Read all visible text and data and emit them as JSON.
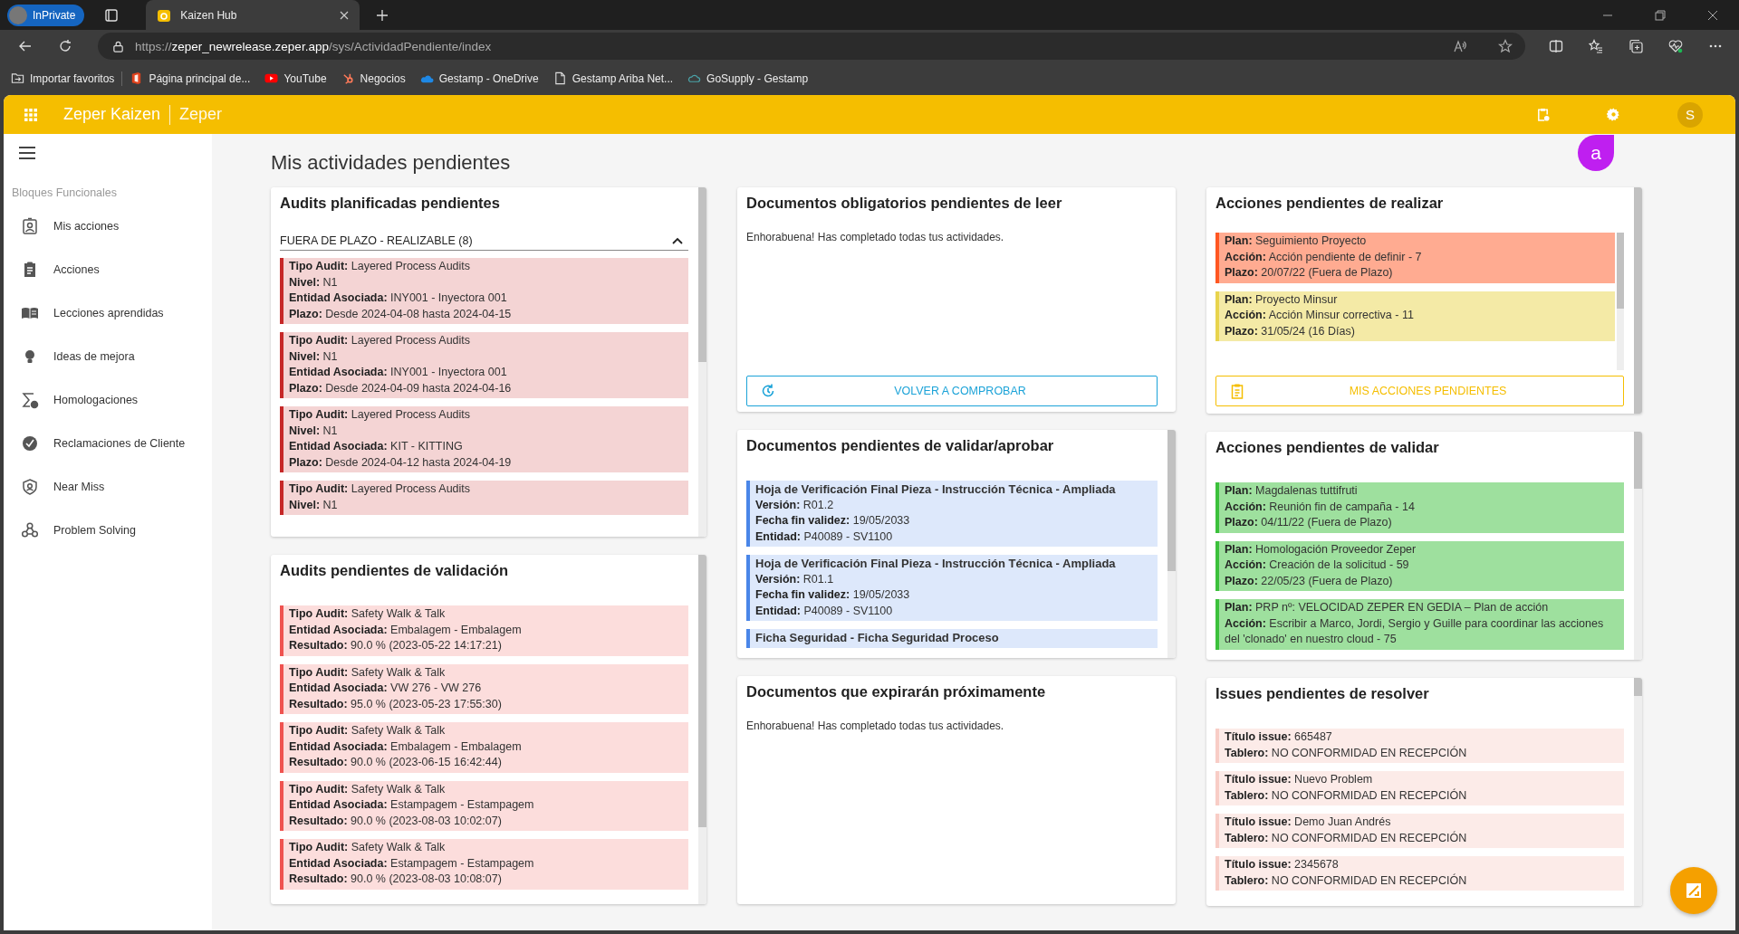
{
  "browser": {
    "private_label": "InPrivate",
    "tabs": [
      {
        "title": "Kaizen Hub",
        "selected": true
      }
    ],
    "address": {
      "scheme": "https://",
      "host": "zeper_newrelease.zeper.app",
      "path": "/sys/ActividadPendiente/index"
    },
    "bookmarks": [
      "Importar favoritos",
      "Página principal de...",
      "YouTube",
      "Negocios",
      "Gestamp - OneDrive",
      "Gestamp Ariba Net...",
      "GoSupply - Gestamp"
    ]
  },
  "app": {
    "brand": "Zeper Kaizen",
    "company": "Zeper",
    "avatar": "S",
    "annotation": "a"
  },
  "sidebar": {
    "section": "Bloques Funcionales",
    "items": [
      {
        "label": "Mis acciones",
        "selected": false
      },
      {
        "label": "Acciones",
        "selected": false
      },
      {
        "label": "Lecciones aprendidas",
        "selected": false
      },
      {
        "label": "Ideas de mejora",
        "selected": false
      },
      {
        "label": "Homologaciones",
        "selected": false
      },
      {
        "label": "Reclamaciones de Cliente",
        "selected": false
      },
      {
        "label": "Near Miss",
        "selected": false
      },
      {
        "label": "Problem Solving",
        "selected": false
      }
    ]
  },
  "page_title": "Mis actividades pendientes",
  "columns": [
    [
      {
        "title": "Audits planificadas pendientes",
        "kind": "audit",
        "group": {
          "label": "FUERA DE PLAZO - REALIZABLE (8)",
          "expanded": true
        },
        "items": [
          {
            "color": "#c62828",
            "lines": [
              "**Tipo Audit:** Layered Process Audits",
              "**Nivel:** N1",
              "**Entidad Asociada:** INY001 - Inyectora 001",
              "**Plazo:** Desde 2024-04-08 hasta 2024-04-15"
            ]
          },
          {
            "color": "#c62828",
            "lines": [
              "**Tipo Audit:** Layered Process Audits",
              "**Nivel:** N1",
              "**Entidad Asociada:** INY001 - Inyectora 001",
              "**Plazo:** Desde 2024-04-09 hasta 2024-04-16"
            ]
          },
          {
            "color": "#c62828",
            "lines": [
              "**Tipo Audit:** Layered Process Audits",
              "**Nivel:** N1",
              "**Entidad Asociada:** KIT - KITTING",
              "**Plazo:** Desde 2024-04-12 hasta 2024-04-19"
            ]
          },
          {
            "color": "#c62828",
            "lines": [
              "**Tipo Audit:** Layered Process Audits",
              "**Nivel:** N1"
            ]
          }
        ]
      },
      {
        "title": "Audits pendientes de validación",
        "kind": "audit",
        "items": [
          {
            "color": "#ef5350",
            "lines": [
              "**Tipo Audit:** Safety Walk & Talk",
              "**Entidad Asociada:** Embalagem - Embalagem",
              "**Resultado:** 90.0 % (2023-05-22 14:17:21)"
            ]
          },
          {
            "color": "#ef5350",
            "lines": [
              "**Tipo Audit:** Safety Walk & Talk",
              "**Entidad Asociada:** VW 276 - VW 276",
              "**Resultado:** 95.0 % (2023-05-23 17:55:30)"
            ]
          },
          {
            "color": "#ef5350",
            "lines": [
              "**Tipo Audit:** Safety Walk & Talk",
              "**Entidad Asociada:** Embalagem - Embalagem",
              "**Resultado:** 90.0 % (2023-06-15 16:42:44)"
            ]
          },
          {
            "color": "#ef5350",
            "lines": [
              "**Tipo Audit:** Safety Walk & Talk",
              "**Entidad Asociada:** Estampagem - Estampagem",
              "**Resultado:** 90.0 % (2023-08-03 10:02:07)"
            ]
          },
          {
            "color": "#ef5350",
            "lines": [
              "**Tipo Audit:** Safety Walk & Talk",
              "**Entidad Asociada:** Estampagem - Estampagem",
              "**Resultado:** 90.0 % (2023-08-03 10:08:07)"
            ]
          }
        ]
      }
    ],
    [
      {
        "title": "Documentos obligatorios pendientes de leer",
        "message": "Enhorabuena! Has completado todas tus actividades.",
        "button": {
          "kind": "refresh",
          "label": "VOLVER A COMPROBAR"
        }
      },
      {
        "title": "Documentos pendientes de validar/aprobar",
        "kind": "document",
        "items": [
          {
            "color": "#4a86e8",
            "heading": "Hoja de Verificación Final Pieza - Instrucción Técnica - Ampliada",
            "lines": [
              "**Versión:** R01.2",
              "**Fecha fin validez:** 19/05/2033",
              "**Entidad:** P40089 - SV1100"
            ]
          },
          {
            "color": "#4a86e8",
            "heading": "Hoja de Verificación Final Pieza - Instrucción Técnica - Ampliada",
            "lines": [
              "**Versión:** R01.1",
              "**Fecha fin validez:** 19/05/2033",
              "**Entidad:** P40089 - SV1100"
            ]
          },
          {
            "color": "#4a86e8",
            "heading": "Ficha Seguridad - Ficha Seguridad Proceso"
          }
        ]
      },
      {
        "title": "Documentos que expirarán próximamente",
        "message": "Enhorabuena! Has completado todas tus actividades."
      }
    ],
    [
      {
        "title": "Acciones pendientes de realizar",
        "kind": "action",
        "inner_scroll": true,
        "items": [
          {
            "color": "#ff5722",
            "lines": [
              "**Plan:** Seguimiento Proyecto",
              "**Acción:** Acción pendiente de definir - 7",
              "**Plazo:** 20/07/22 (Fuera de Plazo)"
            ]
          },
          {
            "color": "#e8d44d",
            "lines": [
              "**Plan:** Proyecto Minsur",
              "**Acción:** Acción Minsur correctiva - 11",
              "**Plazo:** 31/05/24 (16 Días)"
            ]
          }
        ],
        "button": {
          "kind": "actions",
          "label": "MIS ACCIONES PENDIENTES"
        }
      },
      {
        "title": "Acciones pendientes de validar",
        "kind": "action",
        "items": [
          {
            "color": "#3cc13c",
            "lines": [
              "**Plan:** Magdalenas tuttifruti",
              "**Acción:** Reunión fin de campaña - 14",
              "**Plazo:** 04/11/22 (Fuera de Plazo)"
            ]
          },
          {
            "color": "#3cc13c",
            "lines": [
              "**Plan:** Homologación Proveedor Zeper",
              "**Acción:** Creación de la solicitud - 59",
              "**Plazo:** 22/05/23 (Fuera de Plazo)"
            ]
          },
          {
            "color": "#3cc13c",
            "lines": [
              "**Plan:** PRP nº: VELOCIDAD ZEPER EN GEDIA – Plan de acción",
              "**Acción:** Escribir a Marco, Jordi, Sergio y Guille para coordinar las acciones del 'clonado' en nuestro cloud - 75"
            ]
          }
        ]
      },
      {
        "title": "Issues pendientes de resolver",
        "kind": "issue",
        "items": [
          {
            "color": "#f8cdc6",
            "lines": [
              "**Título issue:** 665487",
              "**Tablero:** NO CONFORMIDAD EN RECEPCIÓN"
            ]
          },
          {
            "color": "#f8cdc6",
            "lines": [
              "**Título issue:** Nuevo Problem",
              "**Tablero:** NO CONFORMIDAD EN RECEPCIÓN"
            ]
          },
          {
            "color": "#f8cdc6",
            "lines": [
              "**Título issue:** Demo Juan Andrés",
              "**Tablero:** NO CONFORMIDAD EN RECEPCIÓN"
            ]
          },
          {
            "color": "#f8cdc6",
            "lines": [
              "**Título issue:** 2345678",
              "**Tablero:** NO CONFORMIDAD EN RECEPCIÓN"
            ]
          }
        ]
      }
    ]
  ]
}
